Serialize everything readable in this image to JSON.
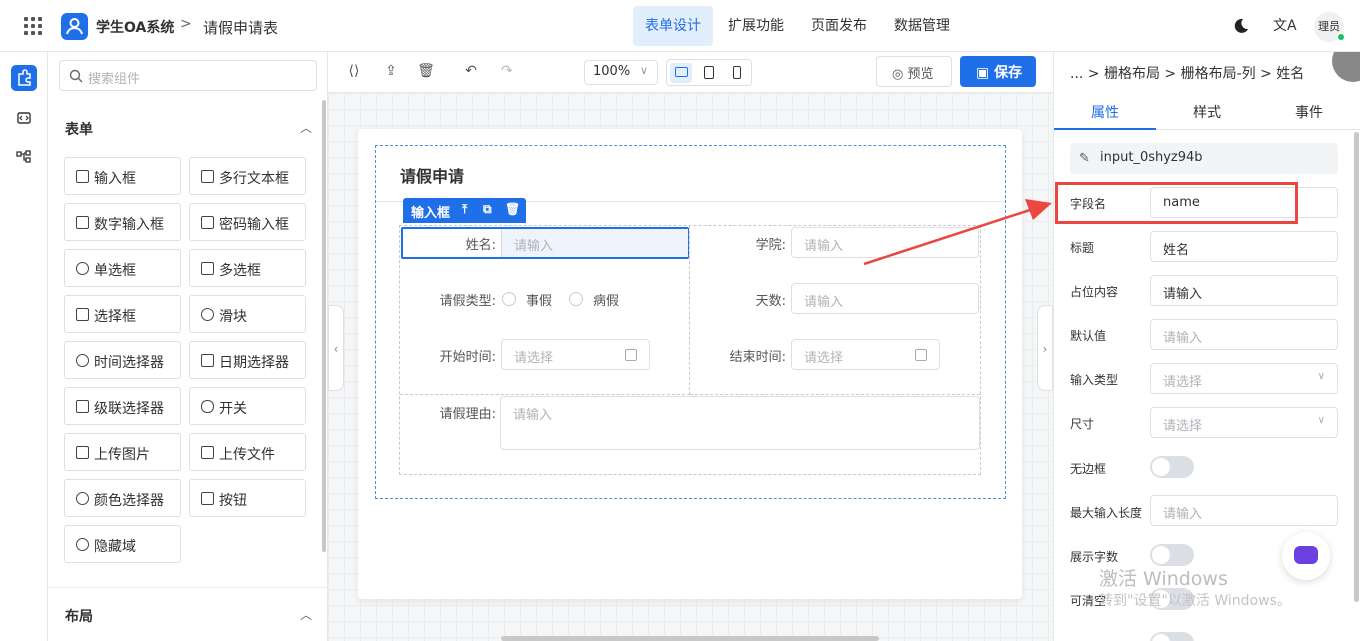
{
  "header": {
    "app_name": "学生OA系统",
    "breadcrumb_separator": ">",
    "form_name": "请假申请表",
    "nav": [
      "表单设计",
      "扩展功能",
      "页面发布",
      "数据管理"
    ],
    "lang_icon_text": "文A",
    "avatar_text": "理员",
    "accent": "#1e6fe8"
  },
  "component_panel": {
    "search_placeholder": "搜索组件",
    "form_section": "表单",
    "layout_section": "布局",
    "components": [
      {
        "label": "输入框",
        "icon": "edit-icon"
      },
      {
        "label": "多行文本框",
        "icon": "textarea-icon"
      },
      {
        "label": "数字输入框",
        "icon": "number-icon"
      },
      {
        "label": "密码输入框",
        "icon": "lock-icon"
      },
      {
        "label": "单选框",
        "icon": "radio-icon"
      },
      {
        "label": "多选框",
        "icon": "checkbox-icon"
      },
      {
        "label": "选择框",
        "icon": "select-icon"
      },
      {
        "label": "滑块",
        "icon": "slider-icon"
      },
      {
        "label": "时间选择器",
        "icon": "clock-icon"
      },
      {
        "label": "日期选择器",
        "icon": "calendar-icon"
      },
      {
        "label": "级联选择器",
        "icon": "cascade-icon"
      },
      {
        "label": "开关",
        "icon": "toggle-icon"
      },
      {
        "label": "上传图片",
        "icon": "image-icon"
      },
      {
        "label": "上传文件",
        "icon": "upload-icon"
      },
      {
        "label": "颜色选择器",
        "icon": "palette-icon"
      },
      {
        "label": "按钮",
        "icon": "button-icon"
      },
      {
        "label": "隐藏域",
        "icon": "eye-off-icon"
      }
    ]
  },
  "toolbar": {
    "zoom": "100%",
    "preview_label": "预览",
    "save_label": "保存"
  },
  "canvas": {
    "form_title": "请假申请",
    "selected_tag": "输入框",
    "fields": {
      "name_label": "姓名:",
      "name_placeholder": "请输入",
      "college_label": "学院:",
      "college_placeholder": "请输入",
      "leave_type_label": "请假类型:",
      "leave_options": [
        "事假",
        "病假"
      ],
      "days_label": "天数:",
      "days_placeholder": "请输入",
      "start_label": "开始时间:",
      "start_placeholder": "请选择",
      "end_label": "结束时间:",
      "end_placeholder": "请选择",
      "reason_label": "请假理由:",
      "reason_placeholder": "请输入"
    }
  },
  "props_panel": {
    "breadcrumb": "... > 栅格布局 > 栅格布局-列 > 姓名",
    "tabs": [
      "属性",
      "样式",
      "事件"
    ],
    "component_id": "input_0shyz94b",
    "field_name_label": "字段名",
    "field_name_value": "name",
    "title_label": "标题",
    "title_value": "姓名",
    "placeholder_label": "占位内容",
    "placeholder_value": "请输入",
    "default_label": "默认值",
    "default_placeholder": "请输入",
    "input_type_label": "输入类型",
    "input_type_placeholder": "请选择",
    "size_label": "尺寸",
    "size_placeholder": "请选择",
    "borderless_label": "无边框",
    "maxlength_label": "最大输入长度",
    "maxlength_placeholder": "请输入",
    "show_count_label": "展示字数",
    "clearable_label": "可清空",
    "highlight_color": "#e9473f"
  },
  "watermark": {
    "line1": "激活 Windows",
    "line2": "转到\"设置\"以激活 Windows。"
  }
}
